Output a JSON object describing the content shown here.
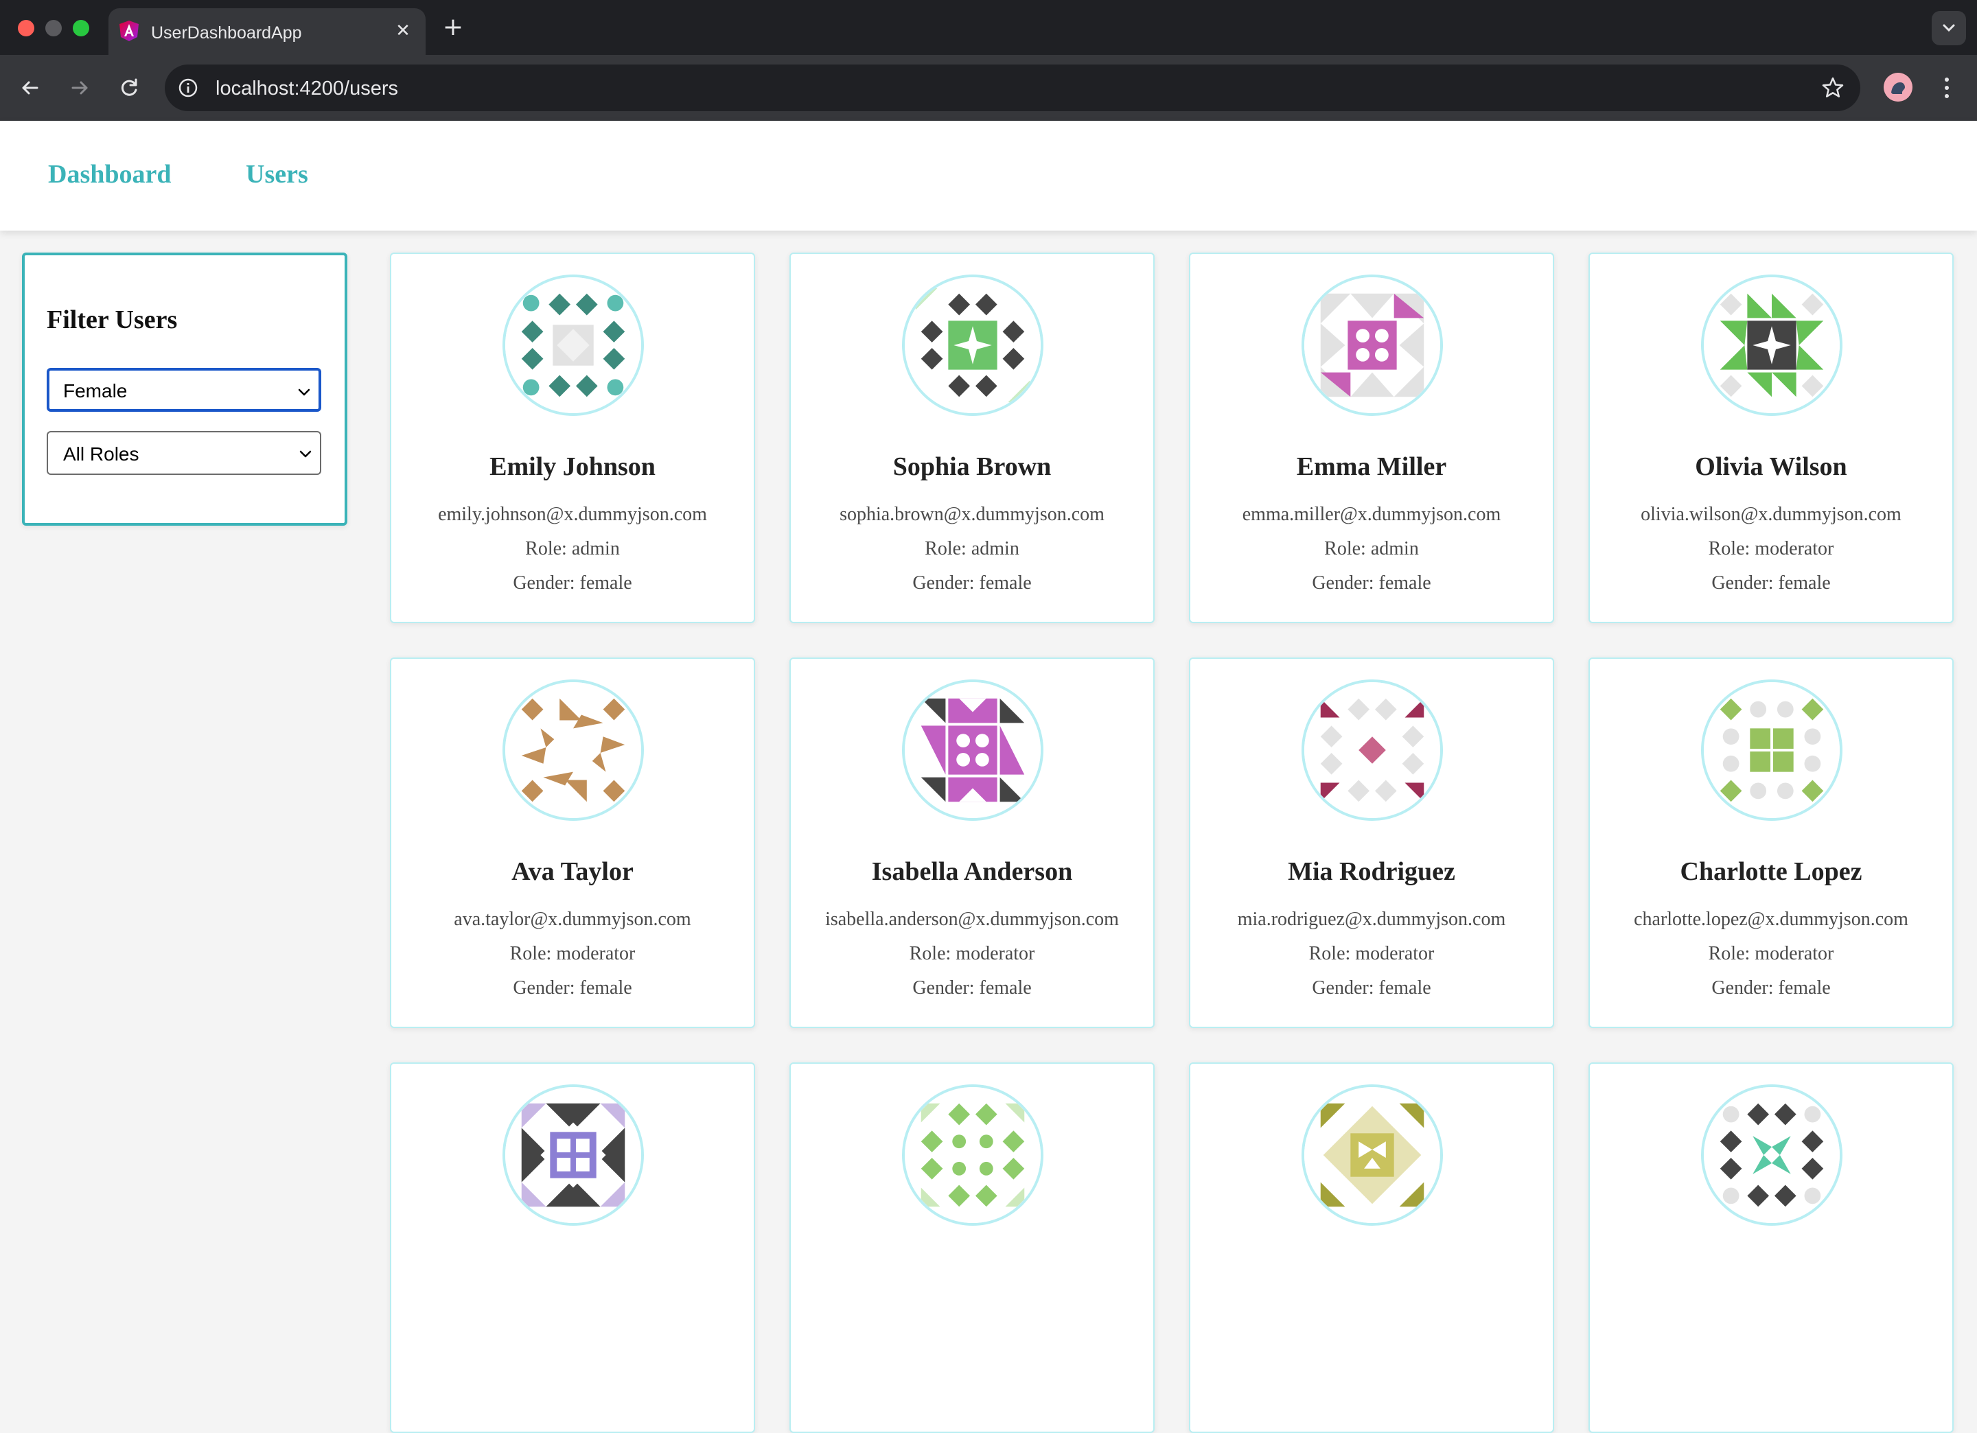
{
  "browser": {
    "tab_title": "UserDashboardApp",
    "url": "localhost:4200/users"
  },
  "nav": {
    "dashboard_label": "Dashboard",
    "users_label": "Users"
  },
  "filter": {
    "title": "Filter Users",
    "gender_value": "Female",
    "role_value": "All Roles"
  },
  "colors": {
    "accent": "#3bb3b8",
    "card_border": "#b9eef2",
    "focus_border": "#1a57c9"
  },
  "users": [
    {
      "name": "Emily Johnson",
      "email": "emily.johnson@x.dummyjson.com",
      "role": "Role: admin",
      "gender": "Gender: female"
    },
    {
      "name": "Sophia Brown",
      "email": "sophia.brown@x.dummyjson.com",
      "role": "Role: admin",
      "gender": "Gender: female"
    },
    {
      "name": "Emma Miller",
      "email": "emma.miller@x.dummyjson.com",
      "role": "Role: admin",
      "gender": "Gender: female"
    },
    {
      "name": "Olivia Wilson",
      "email": "olivia.wilson@x.dummyjson.com",
      "role": "Role: moderator",
      "gender": "Gender: female"
    },
    {
      "name": "Ava Taylor",
      "email": "ava.taylor@x.dummyjson.com",
      "role": "Role: moderator",
      "gender": "Gender: female"
    },
    {
      "name": "Isabella Anderson",
      "email": "isabella.anderson@x.dummyjson.com",
      "role": "Role: moderator",
      "gender": "Gender: female"
    },
    {
      "name": "Mia Rodriguez",
      "email": "mia.rodriguez@x.dummyjson.com",
      "role": "Role: moderator",
      "gender": "Gender: female"
    },
    {
      "name": "Charlotte Lopez",
      "email": "charlotte.lopez@x.dummyjson.com",
      "role": "Role: moderator",
      "gender": "Gender: female"
    },
    {
      "name": "",
      "email": "",
      "role": "",
      "gender": ""
    },
    {
      "name": "",
      "email": "",
      "role": "",
      "gender": ""
    },
    {
      "name": "",
      "email": "",
      "role": "",
      "gender": ""
    },
    {
      "name": "",
      "email": "",
      "role": "",
      "gender": ""
    }
  ]
}
